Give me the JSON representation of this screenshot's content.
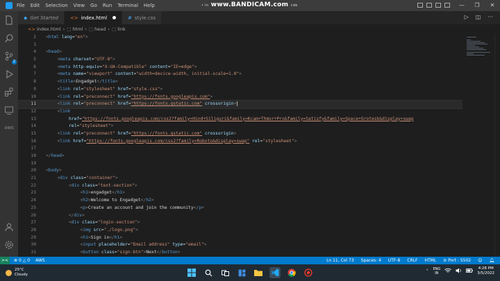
{
  "window": {
    "menu": [
      "File",
      "Edit",
      "Selection",
      "View",
      "Go",
      "Run",
      "Terminal",
      "Help"
    ],
    "title_prefix": "• in",
    "watermark": "www.BANDICAM.com",
    "watermark_suffix": "cde",
    "controls": [
      "—",
      "❐",
      "✕"
    ]
  },
  "activity": {
    "items": [
      "explorer-icon",
      "search-icon",
      "source-control-icon",
      "run-debug-icon",
      "extensions-icon",
      "remote-explorer-icon",
      "aws-icon",
      "account-icon",
      "settings-icon"
    ],
    "source_control_badge": "2",
    "aws_label": "aws"
  },
  "tabs": [
    {
      "label": "Get Started",
      "icon": "vscode-icon",
      "state": "inactive"
    },
    {
      "label": "index.html",
      "icon": "html-file-icon",
      "state": "active-modified"
    },
    {
      "label": "style.css",
      "icon": "css-file-icon",
      "state": "inactive"
    }
  ],
  "breadcrumb": [
    "index.html",
    "html",
    "head",
    "link"
  ],
  "editor": {
    "lines": [
      {
        "n": "2",
        "indent": 0,
        "code": "<html lang=\"en\">"
      },
      {
        "n": "3",
        "indent": 0,
        "code": ""
      },
      {
        "n": "4",
        "indent": 0,
        "code": "<head>"
      },
      {
        "n": "5",
        "indent": 1,
        "code": "<meta charset=\"UTF-8\">"
      },
      {
        "n": "6",
        "indent": 1,
        "code": "<meta http-equiv=\"X-UA-Compatible\" content=\"IE=edge\">"
      },
      {
        "n": "7",
        "indent": 1,
        "code": "<meta name=\"viewport\" content=\"width=device-width, initial-scale=1.0\">"
      },
      {
        "n": "8",
        "indent": 1,
        "code": "<title>Engadget</title>"
      },
      {
        "n": "9",
        "indent": 1,
        "code": "<link rel=\"stylesheet\" href=\"style.css\">"
      },
      {
        "n": "10",
        "indent": 1,
        "code": "<link rel=\"preconnect\" href=\"https://fonts.googleapis.com\">"
      },
      {
        "n": "11",
        "indent": 1,
        "code": "<link rel=\"preconnect\" href=\"https://fonts.gstatic.com\" crossorigin>|",
        "current": true
      },
      {
        "n": "12",
        "indent": 1,
        "code": "<link"
      },
      {
        "n": "13",
        "indent": 2,
        "code": "href=\"https://fonts.googleapis.com/css2?family=Hind+Siliguri&family=Kcam+Thmor+Pro&family=Satisfy&family=Space+Grotesk&display=swap"
      },
      {
        "n": "14",
        "indent": 2,
        "code": "rel=\"stylesheet\">"
      },
      {
        "n": "15",
        "indent": 1,
        "code": "<link rel=\"preconnect\" href=\"https://fonts.gstatic.com\" crossorigin>"
      },
      {
        "n": "16",
        "indent": 1,
        "code": "<link href=\"https://fonts.googleapis.com/css2?family=Roboto&display=swap\" rel=\"stylesheet\">"
      },
      {
        "n": "17",
        "indent": 0,
        "code": ""
      },
      {
        "n": "18",
        "indent": 0,
        "code": "</head>"
      },
      {
        "n": "19",
        "indent": 0,
        "code": ""
      },
      {
        "n": "20",
        "indent": 0,
        "code": "<body>"
      },
      {
        "n": "21",
        "indent": 1,
        "code": "<div class=\"container\">"
      },
      {
        "n": "22",
        "indent": 2,
        "code": "<div class=\"text-section\">"
      },
      {
        "n": "23",
        "indent": 3,
        "code": "<h1>engadget</h1>"
      },
      {
        "n": "24",
        "indent": 3,
        "code": "<h2>Welcome to Engadget</h2>"
      },
      {
        "n": "25",
        "indent": 3,
        "code": "<p>Create an account and join the community</p>"
      },
      {
        "n": "26",
        "indent": 2,
        "code": "</div>"
      },
      {
        "n": "27",
        "indent": 2,
        "code": "<div class=\"login-section\">"
      },
      {
        "n": "28",
        "indent": 3,
        "code": "<img src=\"./logo.png\">"
      },
      {
        "n": "29",
        "indent": 3,
        "code": "<h1>Sign in</h1>"
      },
      {
        "n": "30",
        "indent": 3,
        "code": "<input placeholder=\"Email address\" type=\"email\">"
      },
      {
        "n": "31",
        "indent": 3,
        "code": "<button class=\"sign-btn\">Next</button>"
      }
    ]
  },
  "status": {
    "remote": "><",
    "problems_errors": "0",
    "problems_warnings": "0",
    "aws": "AWS",
    "position": "Ln 11, Col 73",
    "spaces": "Spaces: 4",
    "encoding": "UTF-8",
    "eol": "CRLF",
    "language": "HTML",
    "port": "Port : 5502"
  },
  "taskbar": {
    "temp": "25°C",
    "weather": "Cloudy",
    "lang_top": "ENG",
    "lang_bottom": "IN",
    "time": "4:28 PM",
    "date": "3/5/2022"
  },
  "colors": {
    "tag": "#569cd6",
    "attr": "#9cdcfe",
    "string": "#ce9178",
    "link": "#ce9178",
    "statusbar": "#007acc"
  }
}
